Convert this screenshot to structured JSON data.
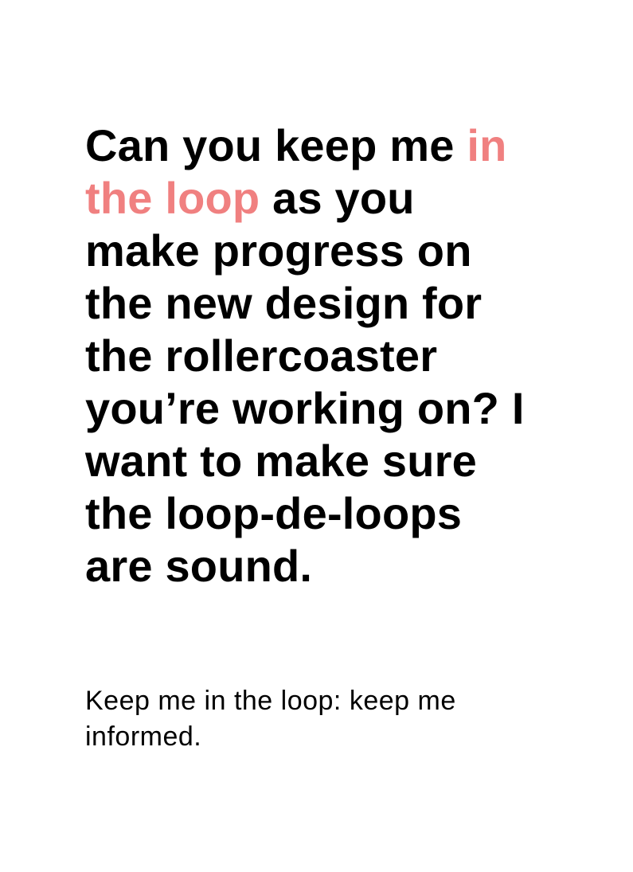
{
  "headline": {
    "line1_before": "Can you keep me ",
    "line1_highlight": "in",
    "line2_highlight": "the loop",
    "line2_after": " as you",
    "line3": "make progress on",
    "line4": "the new design for",
    "line5": "the rollercoaster",
    "line6": "you’re working on? I",
    "line7": "want to make sure",
    "line8": "the loop-de-loops",
    "line9": "are sound.",
    "highlight_color": "#f08080"
  },
  "definition": {
    "line1": "Keep me in the loop: keep me",
    "line2": "informed."
  }
}
